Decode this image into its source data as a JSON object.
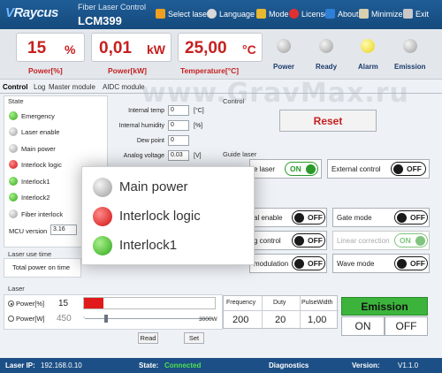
{
  "app": {
    "logo": "Raycus",
    "title": "Fiber Laser Control",
    "model": "LCM399"
  },
  "menu": [
    {
      "label": "Select laser",
      "icon": "laser-select-icon",
      "color": "#f0a020"
    },
    {
      "label": "Language",
      "icon": "language-icon",
      "color": "#d9d9d9"
    },
    {
      "label": "Mode",
      "icon": "mode-icon",
      "color": "#e8b830"
    },
    {
      "label": "License",
      "icon": "license-icon",
      "color": "#e23030"
    },
    {
      "label": "About",
      "icon": "about-icon",
      "color": "#2e7fd8"
    },
    {
      "label": "Minimize",
      "icon": "minimize-icon",
      "color": "#d8d0b0"
    },
    {
      "label": "Exit",
      "icon": "exit-icon",
      "color": "#c8c8c8"
    }
  ],
  "readouts": {
    "power_pct": {
      "value": "15",
      "unit": "%",
      "label": "Power[%]"
    },
    "power_kw": {
      "value": "0,01",
      "unit": "kW",
      "label": "Power[kW]"
    },
    "temperature": {
      "value": "25,00",
      "unit": "°C",
      "label": "Temperature[°C]"
    }
  },
  "indicators": [
    {
      "label": "Power",
      "state": "gray"
    },
    {
      "label": "Ready",
      "state": "gray"
    },
    {
      "label": "Alarm",
      "state": "yellow"
    },
    {
      "label": "Emission",
      "state": "gray"
    }
  ],
  "tabs": [
    "Control",
    "Log",
    "Master module",
    "AIDC module"
  ],
  "state": {
    "title": "State",
    "items": [
      {
        "label": "Emergency",
        "state": "green"
      },
      {
        "label": "Laser enable",
        "state": "gray"
      },
      {
        "label": "Main power",
        "state": "gray"
      },
      {
        "label": "Interlock logic",
        "state": "red"
      },
      {
        "label": "Interlock1",
        "state": "green"
      },
      {
        "label": "Interlock2",
        "state": "green"
      },
      {
        "label": "Fiber interlock",
        "state": "gray"
      }
    ],
    "mcu_label": "MCU version",
    "mcu_value": "3.16"
  },
  "fields": [
    {
      "label": "Internal temp",
      "value": "0",
      "unit": "[°C]"
    },
    {
      "label": "Internal humidity",
      "value": "0",
      "unit": "[%]"
    },
    {
      "label": "Dew point",
      "value": "0",
      "unit": ""
    },
    {
      "label": "Analog voltage",
      "value": "0.03",
      "unit": "[V]"
    }
  ],
  "control_title": "Control",
  "reset_label": "Reset",
  "guide_laser_title": "Guide laser",
  "guide_laser": {
    "label": "e laser",
    "state": "ON"
  },
  "external_control": {
    "label": "External control",
    "state": "OFF"
  },
  "controls": [
    {
      "label": "al enable",
      "state": "OFF"
    },
    {
      "label": "Gate mode",
      "state": "OFF"
    },
    {
      "label": "g control",
      "state": "OFF"
    },
    {
      "label": "Linear correction",
      "state": "ON"
    },
    {
      "label": "modulation",
      "state": "OFF"
    },
    {
      "label": "Wave mode",
      "state": "OFF"
    }
  ],
  "laser_use_time": {
    "title": "Laser use time",
    "label": "Total power on time"
  },
  "laser": {
    "title": "Laser",
    "mode_pct": {
      "label": "Power[%]",
      "value": "15"
    },
    "mode_w": {
      "label": "Power[W]",
      "value": "450"
    },
    "slider_max": "3000W",
    "slider_fraction": 0.15,
    "read_label": "Read",
    "set_label": "Set"
  },
  "pulse": {
    "headers": [
      "Frequency",
      "Duty",
      "PulseWidth"
    ],
    "values": [
      "200",
      "20",
      "1,00"
    ]
  },
  "emission": {
    "title": "Emission",
    "on_label": "ON",
    "off_label": "OFF"
  },
  "zoom": [
    {
      "label": "Main power",
      "state": "gray"
    },
    {
      "label": "Interlock logic",
      "state": "red"
    },
    {
      "label": "Interlock1",
      "state": "green"
    }
  ],
  "status_bar": {
    "ip_label": "Laser IP:",
    "ip_value": "192.168.0.10",
    "state_label": "State:",
    "state_value": "Connected",
    "diagnostics": "Diagnostics",
    "version_label": "Version:",
    "version_value": "V1.1.0"
  },
  "watermark": "www.GravMax.ru",
  "colors": {
    "accent": "#c62020",
    "brand": "#1c4f85",
    "on": "#2a9a2a",
    "emission_bg": "#3cb43c"
  }
}
